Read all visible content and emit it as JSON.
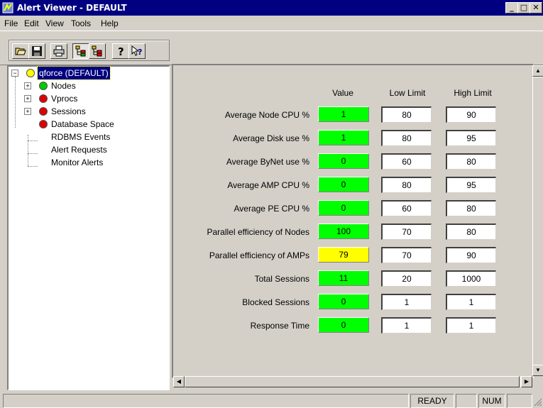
{
  "window": {
    "title": "Alert Viewer - DEFAULT",
    "minimize_label": "_",
    "maximize_label": "□",
    "close_label": "✕"
  },
  "menu": [
    {
      "label": "File"
    },
    {
      "label": "Edit"
    },
    {
      "label": "View"
    },
    {
      "label": "Tools"
    },
    {
      "label": "Help"
    }
  ],
  "toolbar": {
    "buttons": [
      "open-icon",
      "save-icon",
      "print-icon",
      "tree-view-icon",
      "alert-tree-icon",
      "help-icon",
      "context-help-icon"
    ]
  },
  "tree": {
    "root": {
      "label": "qforce (DEFAULT)",
      "status_color": "#ffff00"
    },
    "items": [
      {
        "label": "Nodes",
        "status_color": "#00cc00",
        "expandable": true
      },
      {
        "label": "Vprocs",
        "status_color": "#e00000",
        "expandable": true
      },
      {
        "label": "Sessions",
        "status_color": "#e00000",
        "expandable": true
      },
      {
        "label": "Database Space",
        "status_color": "#e00000",
        "expandable": false
      },
      {
        "label": "RDBMS Events",
        "status_color": "",
        "expandable": false
      },
      {
        "label": "Alert Requests",
        "status_color": "",
        "expandable": false
      },
      {
        "label": "Monitor Alerts",
        "status_color": "",
        "expandable": false
      }
    ]
  },
  "table": {
    "headers": {
      "value": "Value",
      "low": "Low Limit",
      "high": "High Limit"
    },
    "rows": [
      {
        "label": "Average Node CPU %",
        "value": "1",
        "status_color": "#00ff00",
        "low": "80",
        "high": "90"
      },
      {
        "label": "Average Disk use %",
        "value": "1",
        "status_color": "#00ff00",
        "low": "80",
        "high": "95"
      },
      {
        "label": "Average ByNet use %",
        "value": "0",
        "status_color": "#00ff00",
        "low": "60",
        "high": "80"
      },
      {
        "label": "Average AMP CPU %",
        "value": "0",
        "status_color": "#00ff00",
        "low": "80",
        "high": "95"
      },
      {
        "label": "Average PE CPU %",
        "value": "0",
        "status_color": "#00ff00",
        "low": "60",
        "high": "80"
      },
      {
        "label": "Parallel efficiency of Nodes",
        "value": "100",
        "status_color": "#00ff00",
        "low": "70",
        "high": "80"
      },
      {
        "label": "Parallel efficiency of AMPs",
        "value": "79",
        "status_color": "#ffff00",
        "low": "70",
        "high": "90"
      },
      {
        "label": "Total Sessions",
        "value": "11",
        "status_color": "#00ff00",
        "low": "20",
        "high": "1000"
      },
      {
        "label": "Blocked Sessions",
        "value": "0",
        "status_color": "#00ff00",
        "low": "1",
        "high": "1"
      },
      {
        "label": "Response Time",
        "value": "0",
        "status_color": "#00ff00",
        "low": "1",
        "high": "1"
      }
    ]
  },
  "status": {
    "ready": "READY",
    "num": "NUM"
  }
}
